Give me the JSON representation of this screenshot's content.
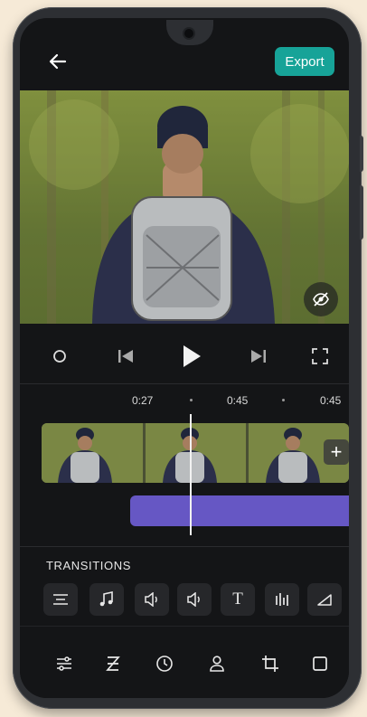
{
  "header": {
    "back_icon": "back-arrow-icon",
    "export_label": "Export"
  },
  "preview": {
    "hide_overlay_icon": "eye-off-icon"
  },
  "playback": {
    "record_icon": "record-icon",
    "prev_icon": "skip-previous-icon",
    "play_icon": "play-icon",
    "next_icon": "skip-next-icon",
    "fullscreen_icon": "fullscreen-icon"
  },
  "timeline": {
    "timestamps": [
      "0:27",
      "0:45",
      "0:45"
    ],
    "add_clip_label": "+"
  },
  "transitions": {
    "label": "TRANSITIONS",
    "tools": [
      {
        "icon": "align-lines-icon"
      },
      {
        "icon": "music-note-icon"
      },
      {
        "icon": "volume-low-icon"
      },
      {
        "icon": "volume-low-icon"
      },
      {
        "icon": "text-icon",
        "glyph": "T"
      },
      {
        "icon": "audio-levels-icon"
      },
      {
        "icon": "slope-icon"
      }
    ]
  },
  "bottom_nav": [
    {
      "icon": "sliders-icon"
    },
    {
      "icon": "letter-z-icon"
    },
    {
      "icon": "clock-icon"
    },
    {
      "icon": "person-icon"
    },
    {
      "icon": "crop-icon"
    },
    {
      "icon": "square-icon"
    }
  ],
  "colors": {
    "accent": "#17a398",
    "audio_track": "#6657c4",
    "background": "#141517"
  }
}
